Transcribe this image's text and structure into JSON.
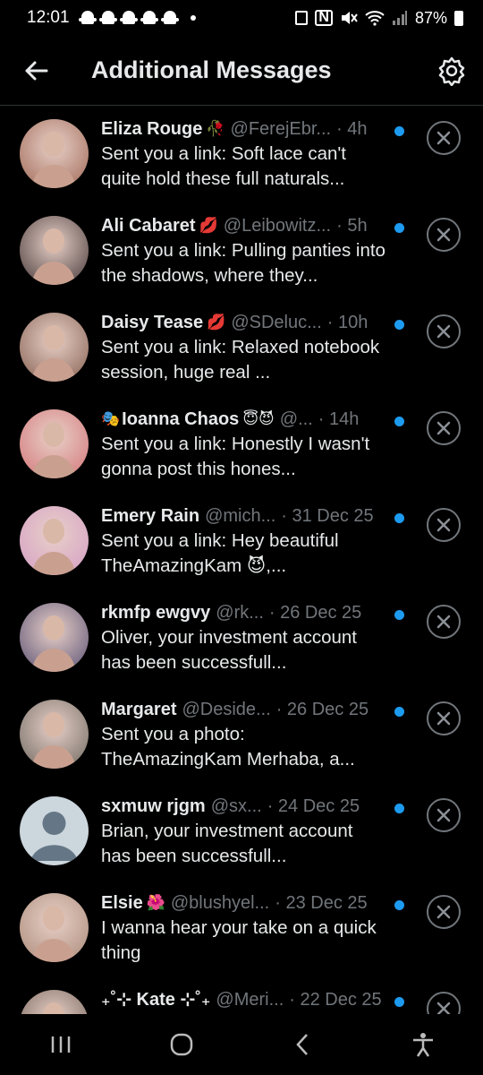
{
  "status_bar": {
    "time": "12:01",
    "battery": "87%",
    "icons": [
      "snapchat-icon",
      "snapchat-icon",
      "snapchat-icon",
      "snapchat-icon",
      "snapchat-icon",
      "dot-icon",
      "alarm-icon",
      "nfc-icon",
      "mute-icon",
      "wifi-icon",
      "signal-icon",
      "battery-icon"
    ]
  },
  "header": {
    "title": "Additional Messages",
    "back_icon": "arrow-left-icon",
    "settings_icon": "gear-icon"
  },
  "colors": {
    "background": "#000000",
    "text_primary": "#e7e9ea",
    "text_secondary": "#71767b",
    "unread_dot": "#1d9bf0",
    "divider": "#2f3336"
  },
  "messages": [
    {
      "name": "Eliza Rouge",
      "emoji": "🥀",
      "handle": "@FerejEbr...",
      "time": "· 4h",
      "text": "Sent you a link: Soft lace can't quite hold these full naturals...",
      "avatar_color": "#b08070",
      "unread": true
    },
    {
      "name": "Ali Cabaret",
      "emoji": "💋",
      "handle": "@Leibowitz...",
      "time": "· 5h",
      "text": "Sent you a link: Pulling panties into the shadows, where they...",
      "avatar_color": "#6a5a58",
      "unread": true
    },
    {
      "name": "Daisy Tease",
      "emoji": "💋",
      "handle": "@SDeluc...",
      "time": "· 10h",
      "text": "Sent you a link: Relaxed notebook session, huge real ...",
      "avatar_color": "#9c7a6c",
      "unread": true
    },
    {
      "name": "Ioanna Chaos",
      "emoji": "😇😈",
      "prefix_emoji": "🎭",
      "handle": "@...",
      "time": "· 14h",
      "text": "Sent you a link: Honestly I wasn't gonna post this hones...",
      "avatar_color": "#d88a8a",
      "unread": true
    },
    {
      "name": "Emery Rain",
      "emoji": "",
      "handle": "@mich...",
      "time": "· 31 Dec 25",
      "text": "Sent you a link: Hey beautiful TheAmazingKam 😈,...",
      "avatar_color": "#d9a9c6",
      "unread": true
    },
    {
      "name": "rkmfp ewgvy",
      "emoji": "",
      "handle": "@rk...",
      "time": "· 26 Dec 25",
      "text": "Oliver, your investment account has been successfull...",
      "avatar_color": "#7a6d86",
      "unread": true
    },
    {
      "name": "Margaret",
      "emoji": "",
      "handle": "@Deside...",
      "time": "· 26 Dec 25",
      "text": "Sent you a photo: TheAmazingKam Merhaba, a...",
      "avatar_color": "#8a8078",
      "unread": true
    },
    {
      "name": "sxmuw rjgm",
      "emoji": "",
      "handle": "@sx...",
      "time": "· 24 Dec 25",
      "text": "Brian, your investment account has been successfull...",
      "avatar_color": "#ccd6dd",
      "default_avatar": true,
      "unread": true
    },
    {
      "name": "Elsie",
      "emoji": "🌺",
      "handle": "@blushyel...",
      "time": "· 23 Dec 25",
      "text": "I wanna hear your take on a quick thing",
      "avatar_color": "#b89a8a",
      "unread": true
    },
    {
      "name": "₊˚⊹ Kate ⊹˚₊",
      "emoji": "",
      "handle": "@Meri...",
      "time": "· 22 Dec 25",
      "text": "",
      "avatar_color": "#8c7a70",
      "unread": true
    }
  ],
  "nav_bar": {
    "icons": [
      "recents-icon",
      "home-icon",
      "back-icon",
      "accessibility-icon"
    ]
  }
}
